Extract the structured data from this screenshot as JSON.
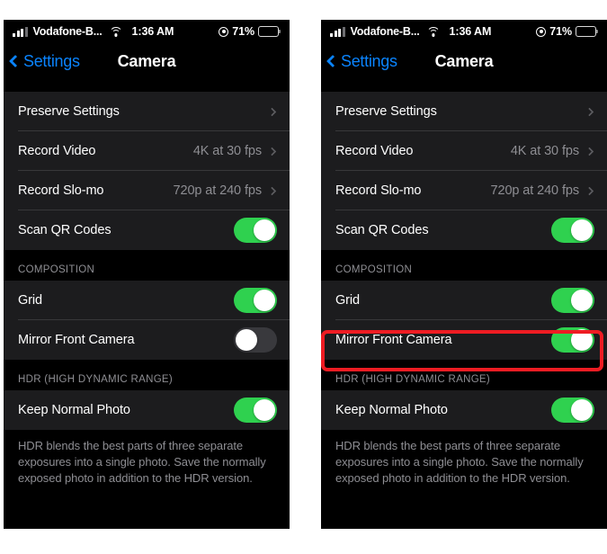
{
  "colors": {
    "accent_blue": "#0a84ff",
    "toggle_on_green": "#2fd14f",
    "toggle_off_gray": "#39393d",
    "cell_background": "#1c1c1e",
    "page_background": "#000000",
    "secondary_text": "#8e8e93",
    "highlight_red": "#ee1c23"
  },
  "status_bar": {
    "carrier": "Vodafone-B...",
    "time": "1:36 AM",
    "battery_percent": "71%",
    "battery_level": 71,
    "signal_icon": "cellular-signal-icon",
    "wifi_icon": "wifi-icon",
    "lock_icon": "rotation-lock-icon",
    "battery_icon": "battery-icon"
  },
  "nav": {
    "back_label": "Settings",
    "title": "Camera",
    "back_icon": "chevron-left-icon"
  },
  "sections": [
    {
      "id": "top",
      "header": "",
      "rows": [
        {
          "label": "Preserve Settings",
          "type": "disclosure",
          "value": ""
        },
        {
          "label": "Record Video",
          "type": "disclosure",
          "value": "4K at 30 fps"
        },
        {
          "label": "Record Slo-mo",
          "type": "disclosure",
          "value": "720p at 240 fps"
        },
        {
          "label": "Scan QR Codes",
          "type": "toggle",
          "value": "",
          "on_left": true,
          "on_right": true
        }
      ]
    },
    {
      "id": "composition",
      "header": "COMPOSITION",
      "rows": [
        {
          "label": "Grid",
          "type": "toggle",
          "value": "",
          "on_left": true,
          "on_right": true
        },
        {
          "label": "Mirror Front Camera",
          "type": "toggle",
          "value": "",
          "on_left": false,
          "on_right": true
        }
      ]
    },
    {
      "id": "hdr",
      "header": "HDR (HIGH DYNAMIC RANGE)",
      "rows": [
        {
          "label": "Keep Normal Photo",
          "type": "toggle",
          "value": "",
          "on_left": true,
          "on_right": true
        }
      ],
      "footer": "HDR blends the best parts of three separate exposures into a single photo. Save the normally exposed photo in addition to the HDR version."
    }
  ],
  "annotation": {
    "highlight_target": "Mirror Front Camera",
    "panel": "right"
  }
}
